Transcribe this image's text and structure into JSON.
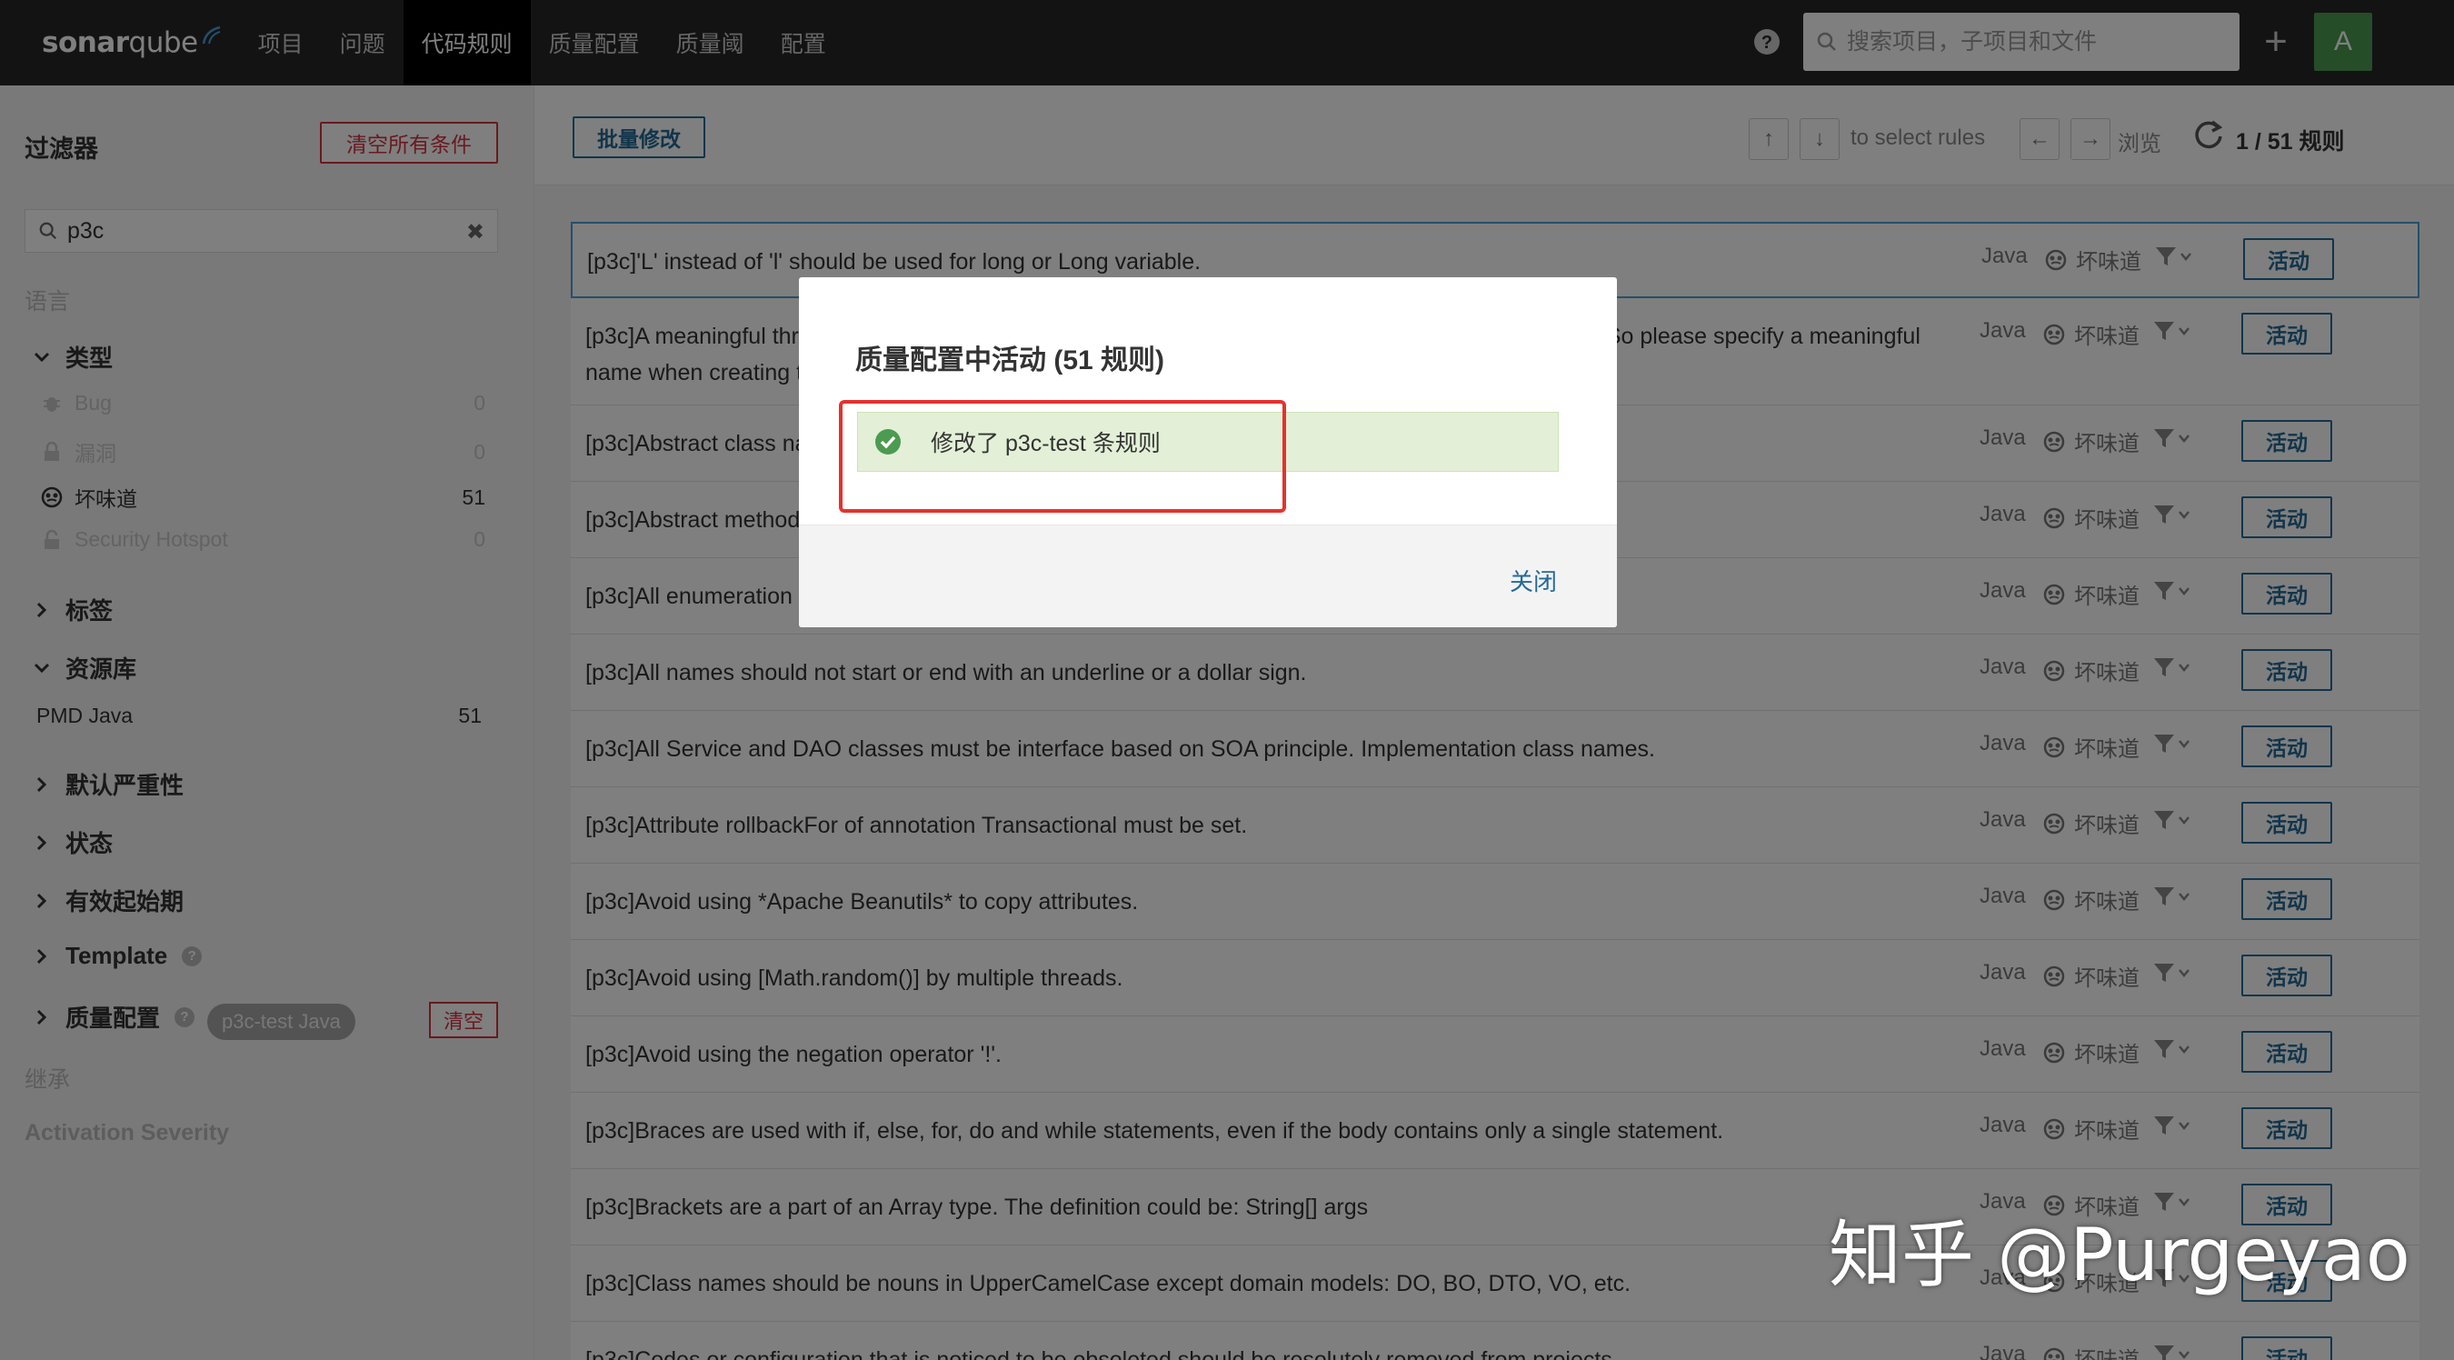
{
  "nav": {
    "logo_bold": "sonar",
    "logo_rest": "qube",
    "items": [
      "项目",
      "问题",
      "代码规则",
      "质量配置",
      "质量阈",
      "配置"
    ],
    "active_index": 2,
    "search_placeholder": "搜索项目，子项目和文件",
    "avatar_letter": "A"
  },
  "sidebar": {
    "title": "过滤器",
    "clear_all": "清空所有条件",
    "search_value": "p3c",
    "language_label": "语言",
    "type_label": "类型",
    "types": [
      {
        "label": "Bug",
        "count": "0",
        "active": false
      },
      {
        "label": "漏洞",
        "count": "0",
        "active": false
      },
      {
        "label": "坏味道",
        "count": "51",
        "active": true
      },
      {
        "label": "Security Hotspot",
        "count": "0",
        "active": false
      }
    ],
    "tags_label": "标签",
    "repo_label": "资源库",
    "repo_item": {
      "label": "PMD Java",
      "count": "51"
    },
    "severity_label": "默认严重性",
    "status_label": "状态",
    "available_since_label": "有效起始期",
    "template_label": "Template",
    "quality_profile_label": "质量配置",
    "quality_profile_pill": "p3c-test Java",
    "clear_label": "清空",
    "inheritance_label": "继承",
    "activation_severity_label": "Activation Severity"
  },
  "toolbar": {
    "bulk_change": "批量修改",
    "select_hint": "to select rules",
    "browse_hint": "浏览",
    "counter": "1 / 51 规则"
  },
  "rules": [
    {
      "title": "[p3c]'L' instead of 'l' should be used for long or Long variable.",
      "selected": true
    },
    {
      "title": "[p3c]A meaningful thread name helps tracking down errors or problems when used with thread pools. So please specify a meaningful name when creating threads or thread pools.",
      "tall": true
    },
    {
      "title": "[p3c]Abstract class names must start with Abstract or Base."
    },
    {
      "title": "[p3c]Abstract methods (including methods in interface) should be commented by Javadoc."
    },
    {
      "title": "[p3c]All enumeration type fields should be commented as Javadoc style."
    },
    {
      "title": "[p3c]All names should not start or end with an underline or a dollar sign."
    },
    {
      "title": "[p3c]All Service and DAO classes must be interface based on SOA principle. Implementation class names."
    },
    {
      "title": "[p3c]Attribute rollbackFor of annotation Transactional must be set."
    },
    {
      "title": "[p3c]Avoid using *Apache Beanutils* to copy attributes."
    },
    {
      "title": "[p3c]Avoid using [Math.random()] by multiple threads."
    },
    {
      "title": "[p3c]Avoid using the negation operator '!'."
    },
    {
      "title": "[p3c]Braces are used with if, else, for, do and while statements, even if the body contains only a single statement."
    },
    {
      "title": "[p3c]Brackets are a part of an Array type. The definition could be: String[] args"
    },
    {
      "title": "[p3c]Class names should be nouns in UpperCamelCase except domain models: DO, BO, DTO, VO, etc."
    },
    {
      "title": "[p3c]Codes or configuration that is noticed to be obsoleted should be resolutely removed from projects."
    }
  ],
  "rule_meta": {
    "lang": "Java",
    "type": "坏味道",
    "activate": "活动"
  },
  "modal": {
    "title": "质量配置中活动 (51 规则)",
    "message": "修改了 p3c-test 条规则",
    "close": "关闭"
  },
  "watermark": "知乎 @Purgeyao",
  "colors": {
    "accent": "#236a97",
    "danger": "#d4333f",
    "success": "#4b9b50",
    "highlight": "#e5322d"
  }
}
